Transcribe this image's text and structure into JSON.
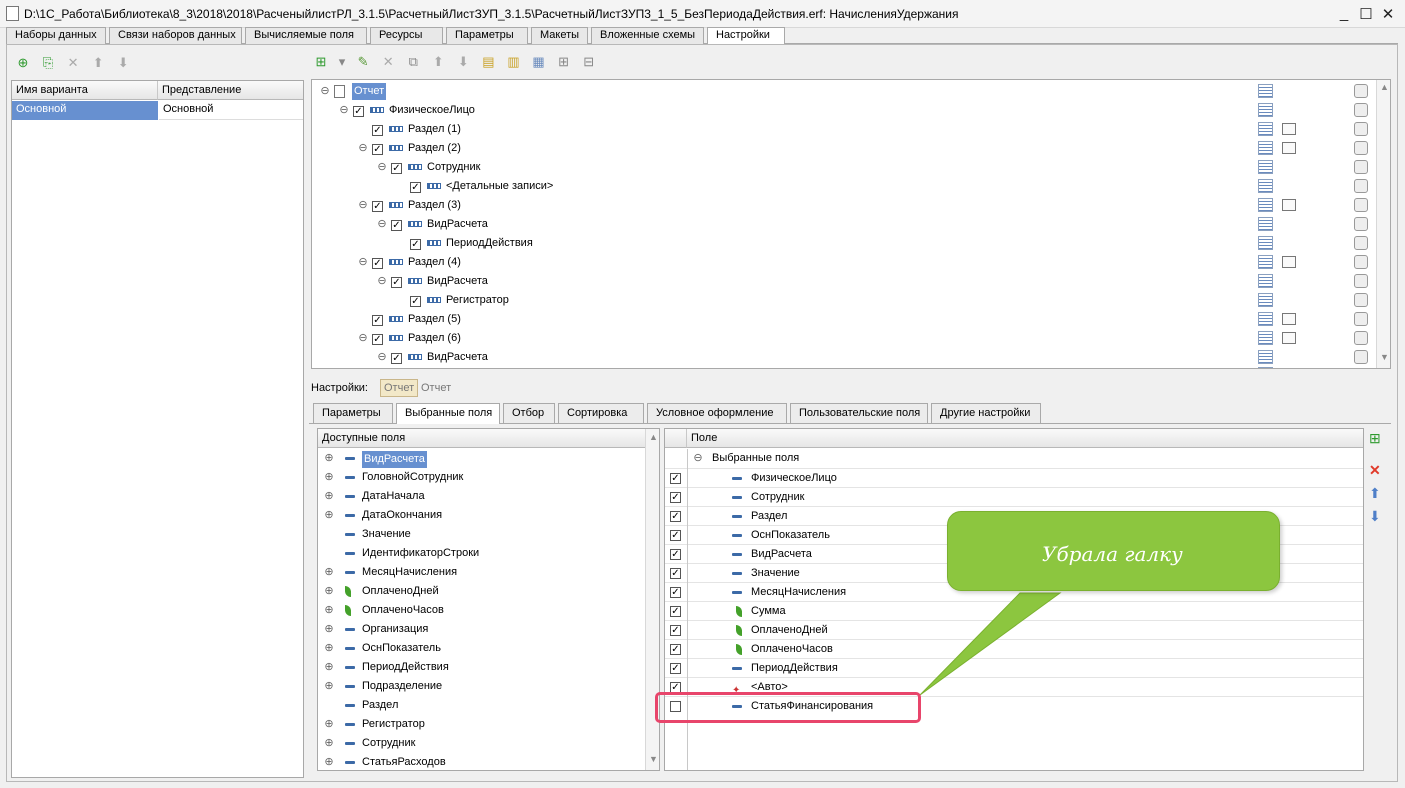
{
  "window": {
    "title": "D:\\1С_Работа\\Библиотека\\8_3\\2018\\2018\\РасченыйлистРЛ_3.1.5\\РасчетныйЛистЗУП_3.1.5\\РасчетныйЛистЗУП3_1_5_БезПериодаДействия.erf: НачисленияУдержания"
  },
  "tabs": [
    "Наборы данных",
    "Связи наборов данных",
    "Вычисляемые поля",
    "Ресурсы",
    "Параметры",
    "Макеты",
    "Вложенные схемы",
    "Настройки"
  ],
  "variants": {
    "col_name": "Имя варианта",
    "col_repr": "Представление",
    "rows": [
      {
        "name": "Основной",
        "repr": "Основной"
      }
    ]
  },
  "tree": [
    {
      "label": "Отчет",
      "level": 0,
      "toggle": "⊖",
      "check": false,
      "selected": true
    },
    {
      "label": "ФизическоеЛицо",
      "level": 1,
      "toggle": "⊖",
      "check": true
    },
    {
      "label": "Раздел (1)",
      "level": 2,
      "toggle": "",
      "check": true,
      "filter": true
    },
    {
      "label": "Раздел (2)",
      "level": 2,
      "toggle": "⊖",
      "check": true,
      "filter": true
    },
    {
      "label": "Сотрудник",
      "level": 3,
      "toggle": "⊖",
      "check": true
    },
    {
      "label": "<Детальные записи>",
      "level": 4,
      "toggle": "",
      "check": true
    },
    {
      "label": "Раздел (3)",
      "level": 2,
      "toggle": "⊖",
      "check": true,
      "filter": true
    },
    {
      "label": "ВидРасчета",
      "level": 3,
      "toggle": "⊖",
      "check": true
    },
    {
      "label": "ПериодДействия",
      "level": 4,
      "toggle": "",
      "check": true
    },
    {
      "label": "Раздел (4)",
      "level": 2,
      "toggle": "⊖",
      "check": true,
      "filter": true
    },
    {
      "label": "ВидРасчета",
      "level": 3,
      "toggle": "⊖",
      "check": true
    },
    {
      "label": "Регистратор",
      "level": 4,
      "toggle": "",
      "check": true
    },
    {
      "label": "Раздел (5)",
      "level": 2,
      "toggle": "",
      "check": true,
      "filter": true
    },
    {
      "label": "Раздел (6)",
      "level": 2,
      "toggle": "⊖",
      "check": true,
      "filter": true
    },
    {
      "label": "ВидРасчета",
      "level": 3,
      "toggle": "⊖",
      "check": true
    }
  ],
  "settings_bar": {
    "label": "Настройки:",
    "btn1": "Отчет",
    "btn2": "Отчет"
  },
  "subtabs": [
    "Параметры",
    "Выбранные поля",
    "Отбор",
    "Сортировка",
    "Условное оформление",
    "Пользовательские поля",
    "Другие настройки"
  ],
  "available": {
    "header": "Доступные поля",
    "rows": [
      {
        "label": "ВидРасчета",
        "exp": true,
        "type": "dash",
        "selected": true
      },
      {
        "label": "ГоловнойСотрудник",
        "exp": true,
        "type": "dash"
      },
      {
        "label": "ДатаНачала",
        "exp": true,
        "type": "dash"
      },
      {
        "label": "ДатаОкончания",
        "exp": true,
        "type": "dash"
      },
      {
        "label": "Значение",
        "exp": false,
        "type": "dash"
      },
      {
        "label": "ИдентификаторСтроки",
        "exp": false,
        "type": "dash"
      },
      {
        "label": "МесяцНачисления",
        "exp": true,
        "type": "dash"
      },
      {
        "label": "ОплаченоДней",
        "exp": true,
        "type": "leaf"
      },
      {
        "label": "ОплаченоЧасов",
        "exp": true,
        "type": "leaf"
      },
      {
        "label": "Организация",
        "exp": true,
        "type": "dash"
      },
      {
        "label": "ОснПоказатель",
        "exp": true,
        "type": "dash"
      },
      {
        "label": "ПериодДействия",
        "exp": true,
        "type": "dash"
      },
      {
        "label": "Подразделение",
        "exp": true,
        "type": "dash"
      },
      {
        "label": "Раздел",
        "exp": false,
        "type": "dash"
      },
      {
        "label": "Регистратор",
        "exp": true,
        "type": "dash"
      },
      {
        "label": "Сотрудник",
        "exp": true,
        "type": "dash"
      },
      {
        "label": "СтатьяРасходов",
        "exp": true,
        "type": "dash"
      }
    ]
  },
  "selected": {
    "header": "Поле",
    "root": "Выбранные поля",
    "rows": [
      {
        "label": "ФизическоеЛицо",
        "check": true,
        "type": "dash"
      },
      {
        "label": "Сотрудник",
        "check": true,
        "type": "dash"
      },
      {
        "label": "Раздел",
        "check": true,
        "type": "dash"
      },
      {
        "label": "ОснПоказатель",
        "check": true,
        "type": "dash"
      },
      {
        "label": "ВидРасчета",
        "check": true,
        "type": "dash"
      },
      {
        "label": "Значение",
        "check": true,
        "type": "dash"
      },
      {
        "label": "МесяцНачисления",
        "check": true,
        "type": "dash"
      },
      {
        "label": "Сумма",
        "check": true,
        "type": "leaf"
      },
      {
        "label": "ОплаченоДней",
        "check": true,
        "type": "leaf"
      },
      {
        "label": "ОплаченоЧасов",
        "check": true,
        "type": "leaf"
      },
      {
        "label": "ПериодДействия",
        "check": true,
        "type": "dash"
      },
      {
        "label": "<Авто>",
        "check": true,
        "type": "auto"
      },
      {
        "label": "СтатьяФинансирования",
        "check": false,
        "type": "dash"
      }
    ]
  },
  "callout": {
    "text": "Убрала галку",
    "color": "#8cc63f",
    "highlight": "#e8456b"
  }
}
